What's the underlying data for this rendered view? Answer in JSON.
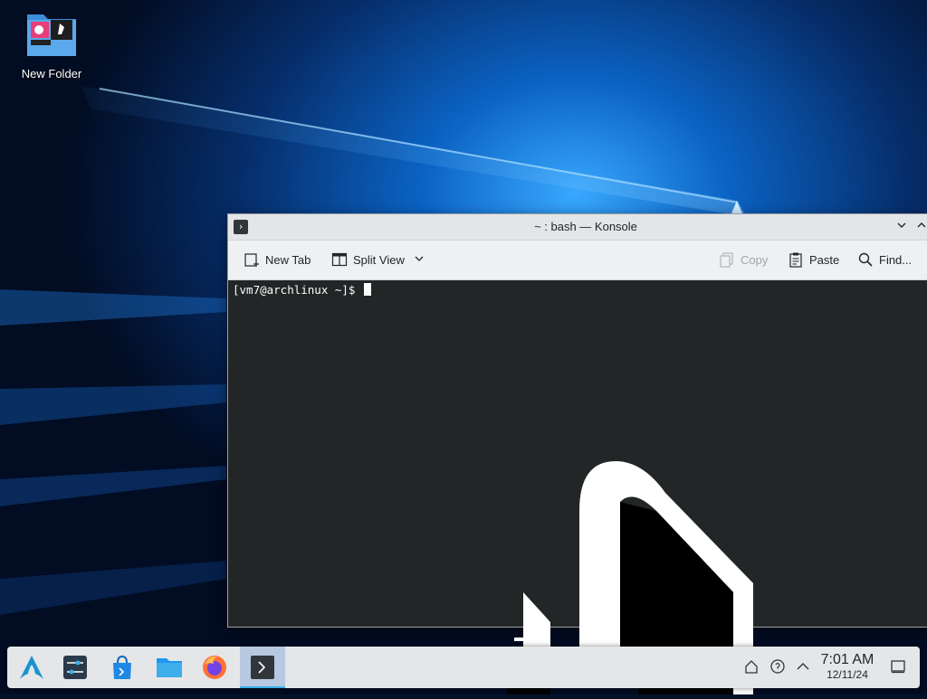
{
  "desktop": {
    "icons": [
      {
        "label": "New Folder",
        "icon": "folder-icon"
      }
    ]
  },
  "konsole": {
    "title": "~ : bash — Konsole",
    "toolbar": {
      "new_tab": "New Tab",
      "split_view": "Split View",
      "copy": "Copy",
      "paste": "Paste",
      "find": "Find..."
    },
    "terminal": {
      "prompt": "[vm7@archlinux ~]$"
    }
  },
  "taskbar": {
    "launchers": [
      {
        "name": "application-launcher",
        "icon": "arch-logo-icon"
      },
      {
        "name": "system-settings",
        "icon": "sliders-icon"
      },
      {
        "name": "discover",
        "icon": "shopping-bag-icon"
      },
      {
        "name": "dolphin",
        "icon": "folder-icon"
      },
      {
        "name": "firefox",
        "icon": "firefox-icon"
      },
      {
        "name": "konsole",
        "icon": "terminal-icon",
        "active": true
      }
    ],
    "clock": {
      "time": "7:01 AM",
      "date": "12/11/24"
    }
  },
  "colors": {
    "accent": "#3daee9",
    "terminal_bg": "#232627",
    "terminal_fg": "#fcfcfc"
  }
}
